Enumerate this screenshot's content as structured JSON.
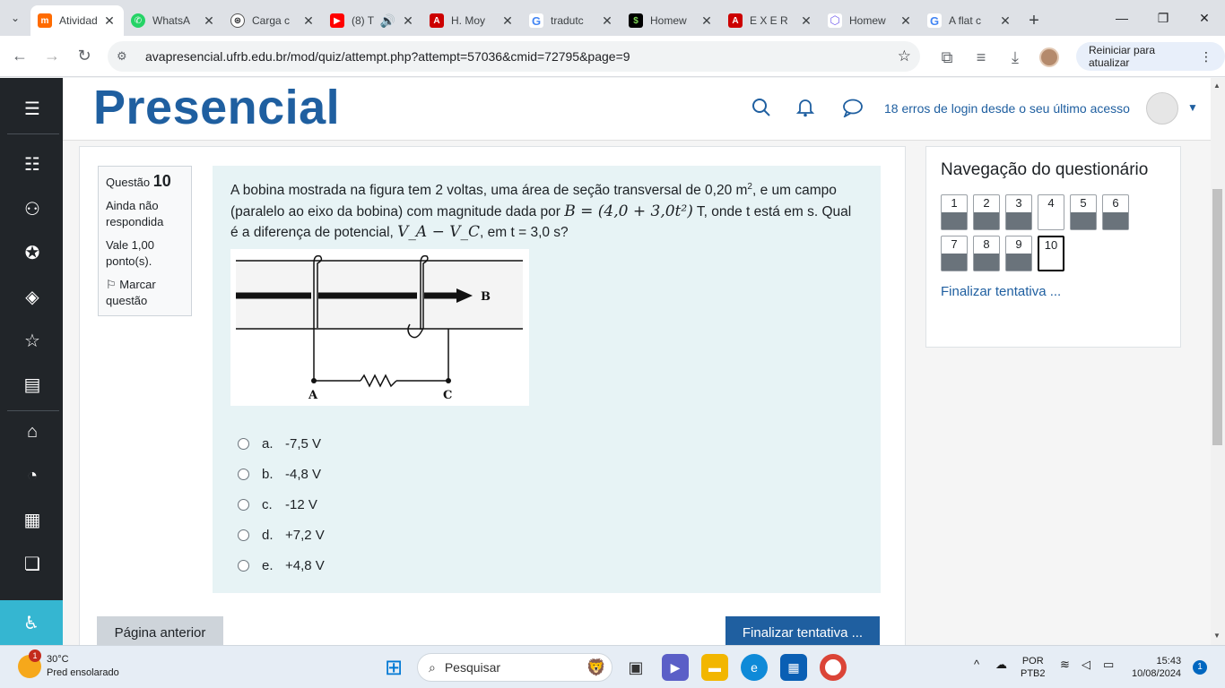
{
  "browser": {
    "tabs": [
      {
        "title": "Atividad",
        "favicon_color": "#ff6b00",
        "favicon": "m"
      },
      {
        "title": "WhatsA",
        "favicon_color": "#25d366",
        "favicon": "w"
      },
      {
        "title": "Carga c",
        "favicon_color": "#202124",
        "favicon": "G"
      },
      {
        "title": "(8) T",
        "favicon_color": "#ff0000",
        "favicon": "▶"
      },
      {
        "title": "H. Moy",
        "favicon_color": "#c00",
        "favicon": "A"
      },
      {
        "title": "tradutc",
        "favicon_color": "#4285f4",
        "favicon": "G"
      },
      {
        "title": "Homew",
        "favicon_color": "#000",
        "favicon": "S"
      },
      {
        "title": "E X E R",
        "favicon_color": "#c00",
        "favicon": "A"
      },
      {
        "title": "Homew",
        "favicon_color": "#7b68ee",
        "favicon": "◆"
      },
      {
        "title": "A flat c",
        "favicon_color": "#4285f4",
        "favicon": "G"
      }
    ],
    "url": "avapresencial.ufrb.edu.br/mod/quiz/attempt.php?attempt=57036&cmid=72795&page=9",
    "reload_label": "Reiniciar para atualizar"
  },
  "header": {
    "logo": "Presencial",
    "login_message": "18 erros de login desde o seu último acesso"
  },
  "question_info": {
    "label": "Questão",
    "number": "10",
    "status": "Ainda não respondida",
    "grade": "Vale 1,00 ponto(s).",
    "flag": "Marcar questão"
  },
  "question": {
    "text_1": "A bobina mostrada na figura tem 2 voltas, uma área de seção transversal de 0,20 m",
    "sup": "2",
    "text_2": ", e um campo (paralelo ao eixo da bobina) com magnitude dada por ",
    "math_1": "B = (4,0 + 3,0t²)",
    "text_3": " T, onde t está em s. Qual é a diferença de potencial, ",
    "math_2": "V_A − V_C",
    "text_4": ", em t = 3,0 s?",
    "fig_label_b": "B",
    "fig_label_a": "A",
    "fig_label_c": "C",
    "answers": [
      {
        "letter": "a.",
        "value": "-7,5 V"
      },
      {
        "letter": "b.",
        "value": "-4,8 V"
      },
      {
        "letter": "c.",
        "value": "-12 V"
      },
      {
        "letter": "d.",
        "value": "+7,2 V"
      },
      {
        "letter": "e.",
        "value": "+4,8 V"
      }
    ]
  },
  "buttons": {
    "prev": "Página anterior",
    "finish": "Finalizar tentativa ..."
  },
  "quiz_nav": {
    "title": "Navegação do questionário",
    "items": [
      "1",
      "2",
      "3",
      "4",
      "5",
      "6",
      "7",
      "8",
      "9",
      "10"
    ],
    "finish_link": "Finalizar tentativa ..."
  },
  "taskbar": {
    "weather_temp": "30°C",
    "weather_desc": "Pred ensolarado",
    "weather_badge": "1",
    "search": "Pesquisar",
    "lang_1": "POR",
    "lang_2": "PTB2",
    "time": "15:43",
    "date": "10/08/2024",
    "notif": "1"
  }
}
